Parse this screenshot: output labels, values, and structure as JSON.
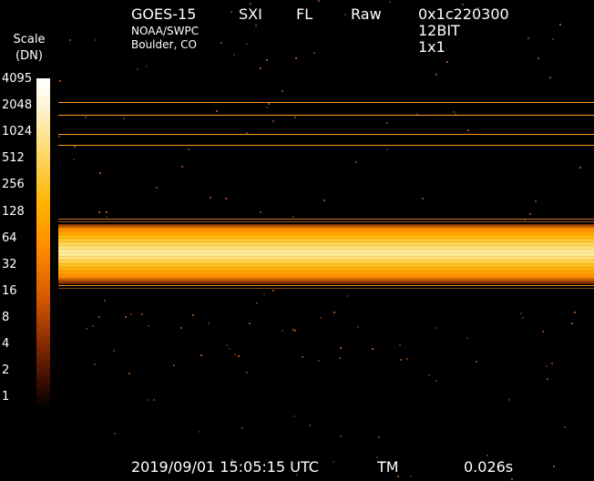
{
  "header": {
    "satellite": "GOES-15",
    "instrument": "SXI",
    "filter": "FL",
    "mode": "Raw",
    "hex_id": "0x1c220300",
    "bit_depth": "12BIT",
    "binning": "1x1",
    "org": "NOAA/SWPC",
    "location": "Boulder, CO"
  },
  "scale": {
    "title": "Scale",
    "unit": "(DN)",
    "ticks": [
      "4095",
      "2048",
      "1024",
      "512",
      "256",
      "128",
      "64",
      "32",
      "16",
      "8",
      "4",
      "2",
      "1"
    ]
  },
  "footer": {
    "datetime": "2019/09/01 15:05:15 UTC",
    "flag": "TM",
    "exposure": "0.026s"
  },
  "colors": {
    "background": "#000000",
    "line": "#ff9a2a",
    "band_core": "#fff1a8",
    "band_edge": "#ff8c00"
  }
}
